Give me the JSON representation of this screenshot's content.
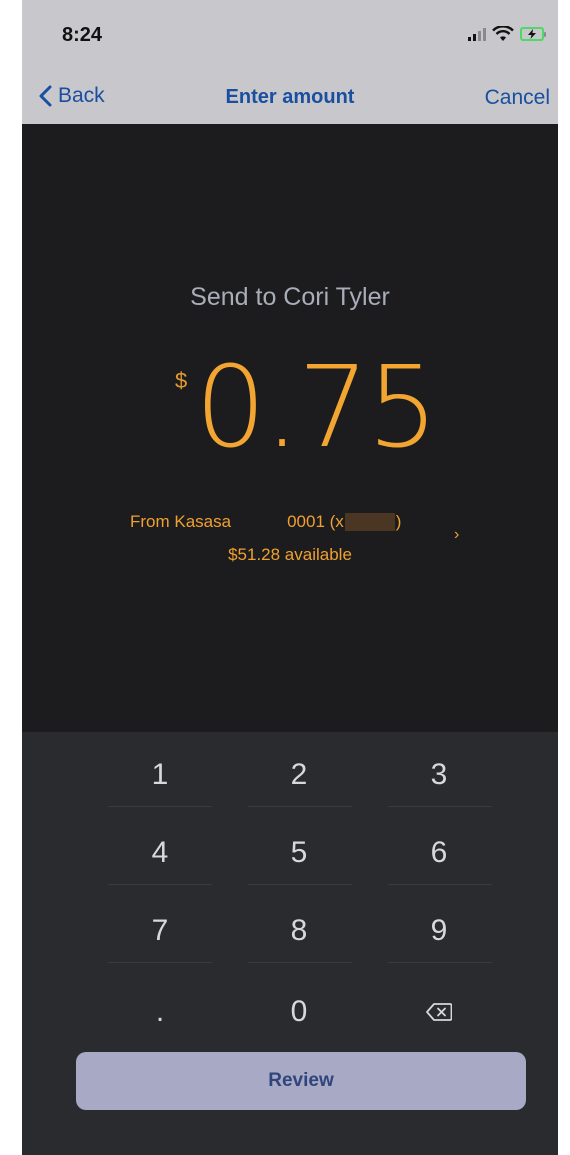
{
  "status_bar": {
    "time": "8:24"
  },
  "nav": {
    "back_label": "Back",
    "title": "Enter amount",
    "cancel_label": "Cancel"
  },
  "payment": {
    "send_to": "Send to Cori Tyler",
    "currency_symbol": "$",
    "amount": "0.75",
    "from_label": "From Kasasa",
    "account_prefix": "0001 (x",
    "account_suffix": ")",
    "available": "$51.28 available"
  },
  "keypad": {
    "keys": [
      "1",
      "2",
      "3",
      "4",
      "5",
      "6",
      "7",
      "8",
      "9",
      ".",
      "0"
    ],
    "delete_icon": "backspace-icon"
  },
  "review_label": "Review",
  "colors": {
    "accent": "#f2a531",
    "nav_text": "#1a4fa0",
    "background": "#1c1c1e",
    "keypad_bg": "#2a2b2f",
    "review_bg": "#a7a9c5"
  }
}
